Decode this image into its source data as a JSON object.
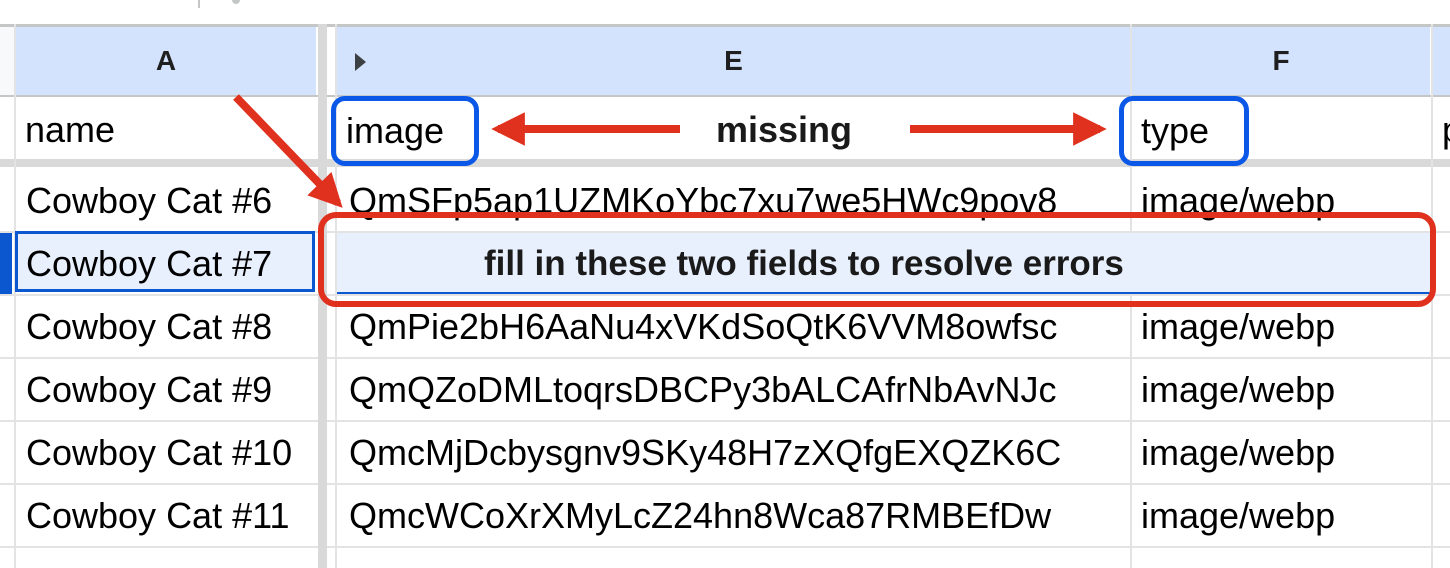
{
  "columns": {
    "a": "A",
    "e": "E",
    "f": "F"
  },
  "header_row": {
    "name": "name",
    "image": "image",
    "type": "type"
  },
  "rows": [
    {
      "name": "Cowboy Cat #6",
      "image": "QmSFp5ap1UZMKoYbc7xu7we5HWc9pov8",
      "type": "image/webp"
    },
    {
      "name": "Cowboy Cat #7",
      "image": "",
      "type": ""
    },
    {
      "name": "Cowboy Cat #8",
      "image": "QmPie2bH6AaNu4xVKdSoQtK6VVM8owfsc",
      "type": "image/webp"
    },
    {
      "name": "Cowboy Cat #9",
      "image": "QmQZoDMLtoqrsDBCPy3bALCAfrNbAvNJc",
      "type": "image/webp"
    },
    {
      "name": "Cowboy Cat #10",
      "image": "QmcMjDcbysgnv9SKy48H7zXQfgEXQZK6C",
      "type": "image/webp"
    },
    {
      "name": "Cowboy Cat #11",
      "image": "QmcWCoXrXMyLcZ24hn8Wca87RMBEfDw",
      "type": "image/webp"
    }
  ],
  "annotations": {
    "missing_label": "missing",
    "fill_in_label": "fill in these two fields to resolve errors"
  },
  "colors": {
    "header_bg": "#d3e3fd",
    "selection_blue": "#0b57d0",
    "highlight_blue": "#0a57e8",
    "arrow_red": "#e0301e",
    "row_selected_bg": "#e8f0fe"
  }
}
